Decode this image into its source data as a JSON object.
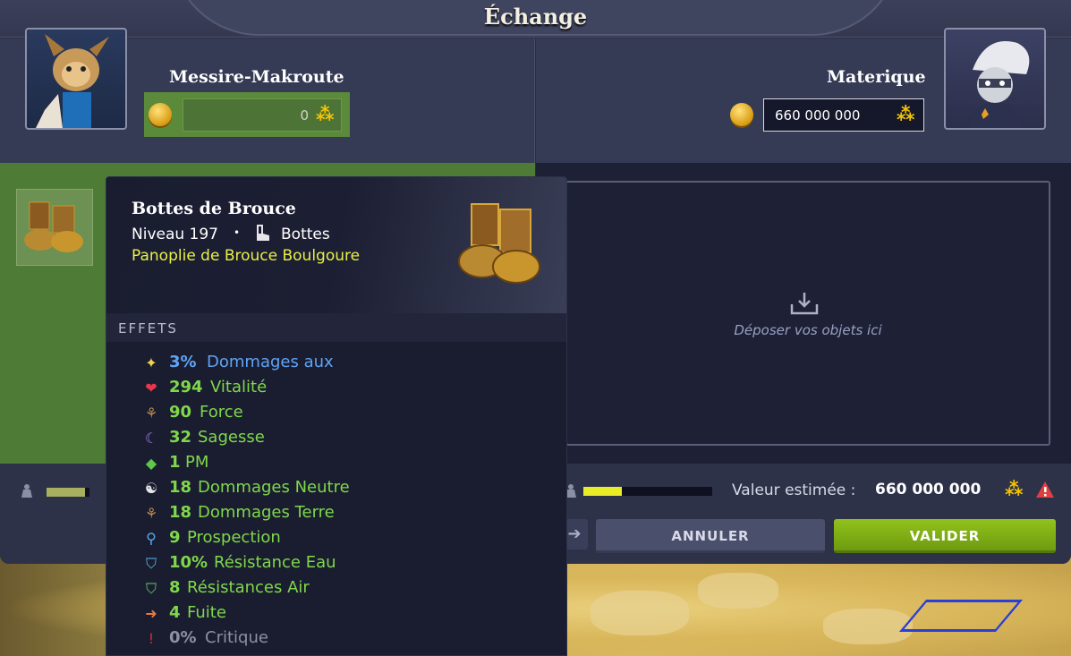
{
  "window": {
    "title": "Échange"
  },
  "left_player": {
    "name": "Messire-Makroute",
    "kamas_value": "0"
  },
  "right_player": {
    "name": "Materique",
    "kamas_value": "660 000 000"
  },
  "drop_zone": {
    "text": "Déposer vos objets ici"
  },
  "footer": {
    "left_weight_fill": 0.9,
    "right_weight_fill": 0.3,
    "estimate_label": "Valeur estimée :",
    "estimate_value": "660 000 000",
    "cancel_label": "ANNULER",
    "validate_label": "VALIDER"
  },
  "tooltip": {
    "name": "Bottes de Brouce",
    "level": "Niveau 197",
    "separator": "•",
    "type": "Bottes",
    "set": "Panoplie de Brouce Boulgoure",
    "section_title": "EFFETS",
    "effects": [
      {
        "value": "3%",
        "label": "Dommages aux",
        "icon": "star-icon",
        "style": "blue"
      },
      {
        "value": "294",
        "label": "Vitalité",
        "icon": "heart-icon",
        "style": "green"
      },
      {
        "value": "90",
        "label": "Force",
        "icon": "earth-icon",
        "style": "green"
      },
      {
        "value": "32",
        "label": "Sagesse",
        "icon": "moon-icon",
        "style": "green"
      },
      {
        "value": "1",
        "label": "PM",
        "icon": "diamond-icon",
        "style": "green"
      },
      {
        "value": "18",
        "label": "Dommages Neutre",
        "icon": "yin-yang-icon",
        "style": "green"
      },
      {
        "value": "18",
        "label": "Dommages Terre",
        "icon": "earth-icon",
        "style": "green"
      },
      {
        "value": "9",
        "label": "Prospection",
        "icon": "magnifier-icon",
        "style": "green"
      },
      {
        "value": "10%",
        "label": "Résistance Eau",
        "icon": "shield-water-icon",
        "style": "green"
      },
      {
        "value": "8",
        "label": "Résistances Air",
        "icon": "shield-air-icon",
        "style": "green"
      },
      {
        "value": "4",
        "label": "Fuite",
        "icon": "escape-icon",
        "style": "green"
      },
      {
        "value": "0%",
        "label": "Critique",
        "icon": "exclamation-icon",
        "style": "grey"
      }
    ]
  },
  "colors": {
    "accent_green": "#7fd84a",
    "accent_blue": "#5fa4f4",
    "set_yellow": "#e8f04a",
    "validate_green": "#92c21c",
    "kama_yellow": "#f5c400"
  }
}
